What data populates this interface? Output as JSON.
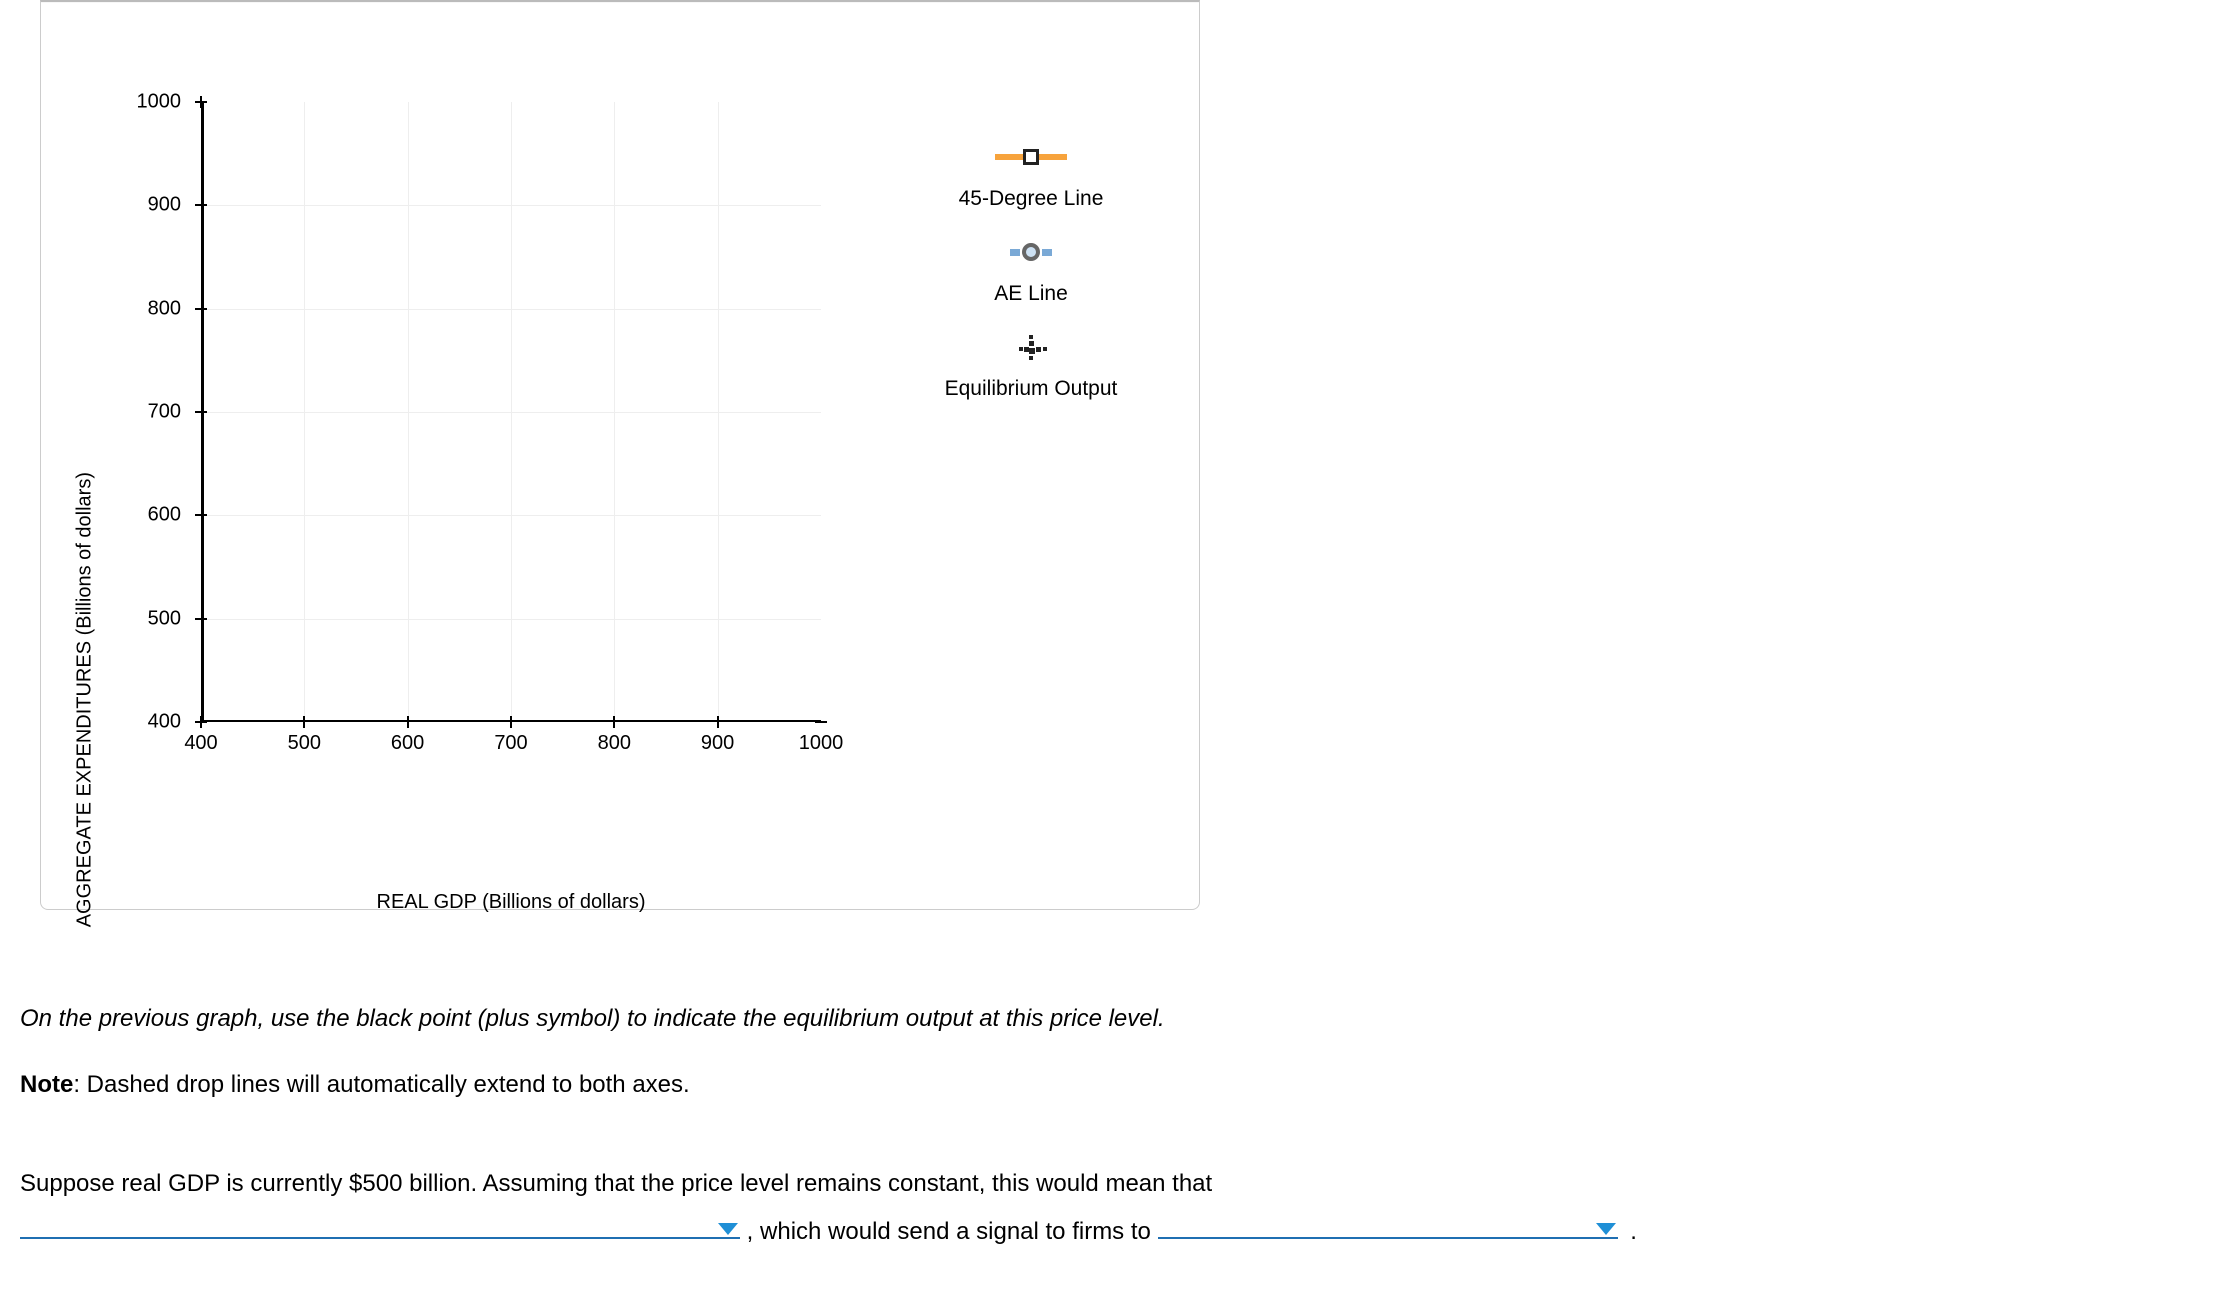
{
  "chart_data": {
    "type": "scatter",
    "title": "",
    "xlabel": "REAL GDP (Billions of dollars)",
    "ylabel": "AGGREGATE EXPENDITURES (Billions of dollars)",
    "xlim": [
      400,
      1000
    ],
    "ylim": [
      400,
      1000
    ],
    "x_ticks": [
      400,
      500,
      600,
      700,
      800,
      900,
      1000
    ],
    "y_ticks": [
      400,
      500,
      600,
      700,
      800,
      900,
      1000
    ],
    "series": [
      {
        "name": "45-Degree Line",
        "marker": "square",
        "color": "#f7a33c",
        "values": []
      },
      {
        "name": "AE Line",
        "marker": "circle",
        "color": "#7aa9d6",
        "values": []
      },
      {
        "name": "Equilibrium Output",
        "marker": "plus",
        "color": "#000000",
        "values": []
      }
    ],
    "grid": true,
    "legend_position": "right"
  },
  "legend": {
    "items": [
      {
        "label": "45-Degree Line"
      },
      {
        "label": "AE Line"
      },
      {
        "label": "Equilibrium Output"
      }
    ]
  },
  "text": {
    "instruction": "On the previous graph, use the black point (plus symbol) to indicate the equilibrium output at this price level.",
    "note_label": "Note",
    "note_body": ": Dashed drop lines will automatically extend to both axes.",
    "question_part1": "Suppose real GDP is currently $500 billion. Assuming that the price level remains constant, this would mean that",
    "question_sep": " , which would send a signal to firms to ",
    "period": "."
  },
  "dropdowns": {
    "blank1": {
      "value": ""
    },
    "blank2": {
      "value": ""
    }
  }
}
